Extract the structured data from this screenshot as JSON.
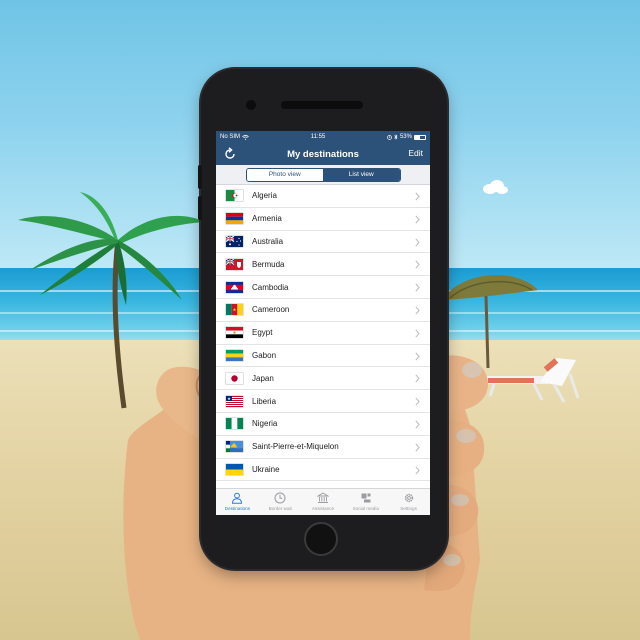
{
  "status_bar": {
    "carrier": "No SIM",
    "time": "11:55",
    "battery": "53%",
    "icons": [
      "wifi-icon",
      "alarm-icon",
      "bluetooth-icon",
      "battery-icon"
    ]
  },
  "nav_bar": {
    "title": "My destinations",
    "left_icon": "refresh-icon",
    "right_label": "Edit"
  },
  "segmented_control": {
    "options": [
      {
        "label": "Photo view",
        "selected": false
      },
      {
        "label": "List view",
        "selected": true
      }
    ]
  },
  "destinations": [
    {
      "name": "Algeria",
      "flag": "algeria"
    },
    {
      "name": "Armenia",
      "flag": "armenia"
    },
    {
      "name": "Australia",
      "flag": "australia"
    },
    {
      "name": "Bermuda",
      "flag": "bermuda"
    },
    {
      "name": "Cambodia",
      "flag": "cambodia"
    },
    {
      "name": "Cameroon",
      "flag": "cameroon"
    },
    {
      "name": "Egypt",
      "flag": "egypt"
    },
    {
      "name": "Gabon",
      "flag": "gabon"
    },
    {
      "name": "Japan",
      "flag": "japan"
    },
    {
      "name": "Liberia",
      "flag": "liberia"
    },
    {
      "name": "Nigeria",
      "flag": "nigeria"
    },
    {
      "name": "Saint-Pierre-et-Miquelon",
      "flag": "saint-pierre-et-miquelon"
    },
    {
      "name": "Ukraine",
      "flag": "ukraine"
    }
  ],
  "tab_bar": {
    "active": "Destinations",
    "tabs": [
      {
        "label": "Destinations",
        "icon": "person-icon"
      },
      {
        "label": "Border wait",
        "icon": "clock-icon"
      },
      {
        "label": "Assistance",
        "icon": "building-icon"
      },
      {
        "label": "Social media",
        "icon": "social-media-icon"
      },
      {
        "label": "Settings",
        "icon": "gear-icon"
      }
    ]
  },
  "colors": {
    "nav_blue": "#2d5279",
    "tab_active": "#2b7bd6",
    "sky": "#8fd3ee",
    "sea": "#1b9cd2",
    "sand": "#e4d4a5"
  }
}
